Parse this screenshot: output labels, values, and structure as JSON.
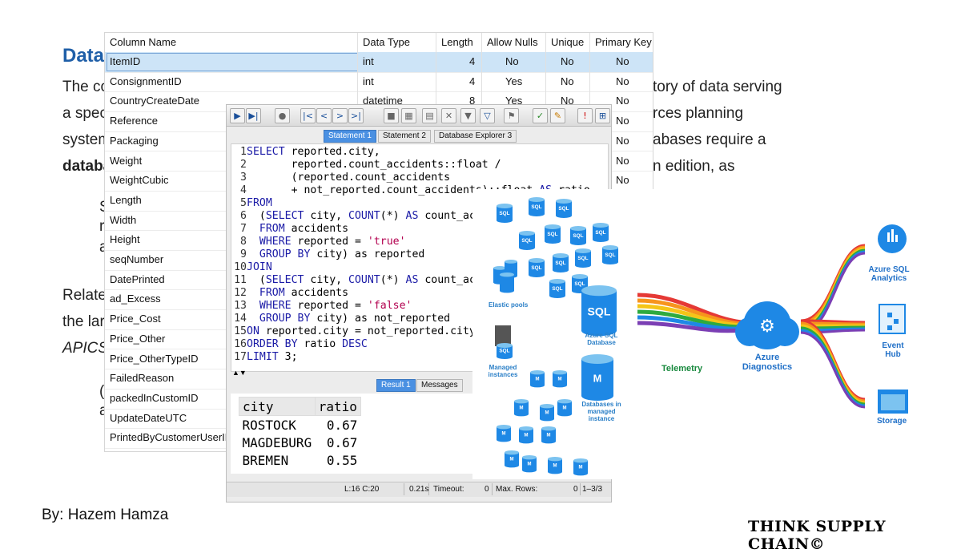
{
  "slide": {
    "title": "Data",
    "lines": [
      "The co",
      "a spec",
      "system",
      "databa",
      "S",
      "r",
      "a",
      "Relate",
      "the lar",
      "APICS",
      "(",
      "a"
    ],
    "right_fragments": [
      "tory of data serving",
      "rces planning",
      "abases require a",
      "n edition, as"
    ]
  },
  "column_table": {
    "headers": [
      "Column Name",
      "Data Type",
      "Length",
      "Allow Nulls",
      "Unique",
      "Primary Key"
    ],
    "rows": [
      {
        "name": "ItemID",
        "type": "int",
        "length": "4",
        "nulls": "No",
        "unique": "No",
        "pk": "No"
      },
      {
        "name": "ConsignmentID",
        "type": "int",
        "length": "4",
        "nulls": "Yes",
        "unique": "No",
        "pk": "No"
      },
      {
        "name": "CountryCreateDate",
        "type": "datetime",
        "length": "8",
        "nulls": "Yes",
        "unique": "No",
        "pk": "No"
      },
      {
        "name": "Reference",
        "type": "",
        "length": "",
        "nulls": "",
        "unique": "",
        "pk": "No"
      },
      {
        "name": "Packaging",
        "type": "",
        "length": "",
        "nulls": "",
        "unique": "",
        "pk": "No"
      },
      {
        "name": "Weight",
        "type": "",
        "length": "",
        "nulls": "",
        "unique": "",
        "pk": "No"
      },
      {
        "name": "WeightCubic",
        "type": "",
        "length": "",
        "nulls": "",
        "unique": "",
        "pk": "No"
      },
      {
        "name": "Length"
      },
      {
        "name": "Width"
      },
      {
        "name": "Height"
      },
      {
        "name": "seqNumber"
      },
      {
        "name": "DatePrinted"
      },
      {
        "name": "ad_Excess"
      },
      {
        "name": "Price_Cost"
      },
      {
        "name": "Price_Other"
      },
      {
        "name": "Price_OtherTypeID"
      },
      {
        "name": "FailedReason"
      },
      {
        "name": "packedInCustomID"
      },
      {
        "name": "UpdateDateUTC"
      },
      {
        "name": "PrintedByCustomerUserID"
      }
    ]
  },
  "sql_window": {
    "tabs": [
      "Statement 1",
      "Statement 2",
      "Database Explorer 3"
    ],
    "code_lines": [
      "SELECT reported.city,",
      "       reported.count_accidents::float /",
      "       (reported.count_accidents",
      "       + not_reported.count_accidents)::float AS ratio",
      "FROM",
      "  (SELECT city, COUNT(*) AS count_accidents",
      "  FROM accidents",
      "  WHERE reported = 'true'",
      "  GROUP BY city) as reported",
      "JOIN",
      "  (SELECT city, COUNT(*) AS count_accidents",
      "  FROM accidents",
      "  WHERE reported = 'false'",
      "  GROUP BY city) as not_reported",
      "ON reported.city = not_reported.city",
      "ORDER BY ratio DESC",
      "LIMIT 3;"
    ],
    "result_tabs": [
      "Result 1",
      "Messages"
    ],
    "result_headers": [
      "city",
      "ratio"
    ],
    "result_rows": [
      [
        "ROSTOCK",
        "0.67"
      ],
      [
        "MAGDEBURG",
        "0.67"
      ],
      [
        "BREMEN",
        "0.55"
      ]
    ],
    "status": {
      "position": "L:16 C:20",
      "time": "0.21s",
      "timeout_label": "Timeout:",
      "timeout": "0",
      "maxrows_label": "Max. Rows:",
      "maxrows": "0",
      "range": "1–3/3"
    }
  },
  "azure": {
    "labels": {
      "elastic": "Elastic pools",
      "sqldb": "Azure SQL Database",
      "managed": "Managed instances",
      "dbmanaged": "Databases in managed instance",
      "telemetry": "Telemetry",
      "diagnostics": "Azure Diagnostics",
      "analytics": "Azure SQL Analytics",
      "eventhub": "Event Hub",
      "storage": "Storage"
    },
    "glyph_sql": "SQL",
    "glyph_m": "M",
    "colors": {
      "blue": "#1e88e5",
      "light": "#7cc3f0",
      "dark": "#0b5fae",
      "red": "#e53935",
      "orange": "#f7941d",
      "yellow": "#f5c518",
      "green": "#2eaa3f",
      "purple": "#7b3fb4"
    }
  },
  "footer": {
    "byline": "By: Hazem Hamza",
    "brand": "THINK SUPPLY CHAIN©"
  }
}
